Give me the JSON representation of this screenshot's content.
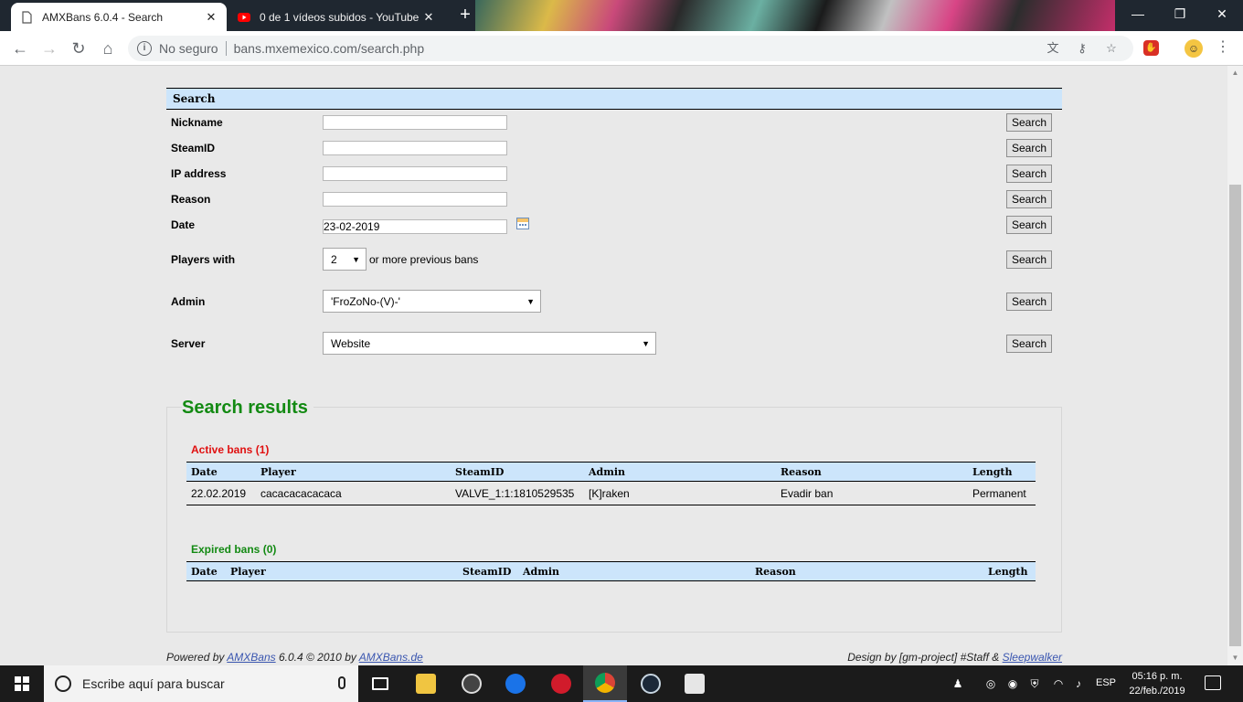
{
  "browser": {
    "tabs": [
      {
        "title": "AMXBans 6.0.4 - Search",
        "close": "✕"
      },
      {
        "title": "0 de 1 vídeos subidos - YouTube",
        "close": "✕"
      }
    ],
    "new_tab": "+",
    "window_controls": {
      "minimize": "—",
      "maximize": "❐",
      "close": "✕"
    },
    "security_label": "No seguro",
    "url": "bans.mxemexico.com/search.php"
  },
  "search": {
    "header": "Search",
    "button_label": "Search",
    "fields": {
      "nickname": {
        "label": "Nickname",
        "value": ""
      },
      "steamid": {
        "label": "SteamID",
        "value": ""
      },
      "ip": {
        "label": "IP address",
        "value": ""
      },
      "reason": {
        "label": "Reason",
        "value": ""
      },
      "date": {
        "label": "Date",
        "value": "23-02-2019"
      }
    },
    "players_with": {
      "label": "Players with",
      "selected": "2",
      "suffix": "or more previous bans"
    },
    "admin": {
      "label": "Admin",
      "selected": "'FroZoNo-(V)-'"
    },
    "server": {
      "label": "Server",
      "selected": "Website"
    }
  },
  "results": {
    "title": "Search results",
    "active": {
      "title": "Active bans (1)",
      "columns": [
        "Date",
        "Player",
        "SteamID",
        "Admin",
        "Reason",
        "Length"
      ],
      "rows": [
        [
          "22.02.2019",
          "cacacacacacaca",
          "VALVE_1:1:1810529535",
          "[K]raken",
          "Evadir ban",
          "Permanent"
        ]
      ]
    },
    "expired": {
      "title": "Expired bans (0)",
      "columns": [
        "Date",
        "Player",
        "SteamID",
        "Admin",
        "Reason",
        "Length"
      ]
    }
  },
  "footer": {
    "left_prefix": "Powered by ",
    "left_link1": "AMXBans",
    "left_mid": " 6.0.4 © 2010 by ",
    "left_link2": "AMXBans.de",
    "right_prefix": "Design by [gm-project] #Staff & ",
    "right_link": "Sleepwalker"
  },
  "taskbar": {
    "search_placeholder": "Escribe aquí para buscar",
    "language": "ESP",
    "time": "05:16 p. m.",
    "date": "22/feb./2019"
  },
  "colors": {
    "header_bg": "#cce5fb",
    "results_title": "#138a13",
    "active_bans": "#e01010",
    "expired_bans": "#138a13",
    "link": "#3a56b0"
  }
}
